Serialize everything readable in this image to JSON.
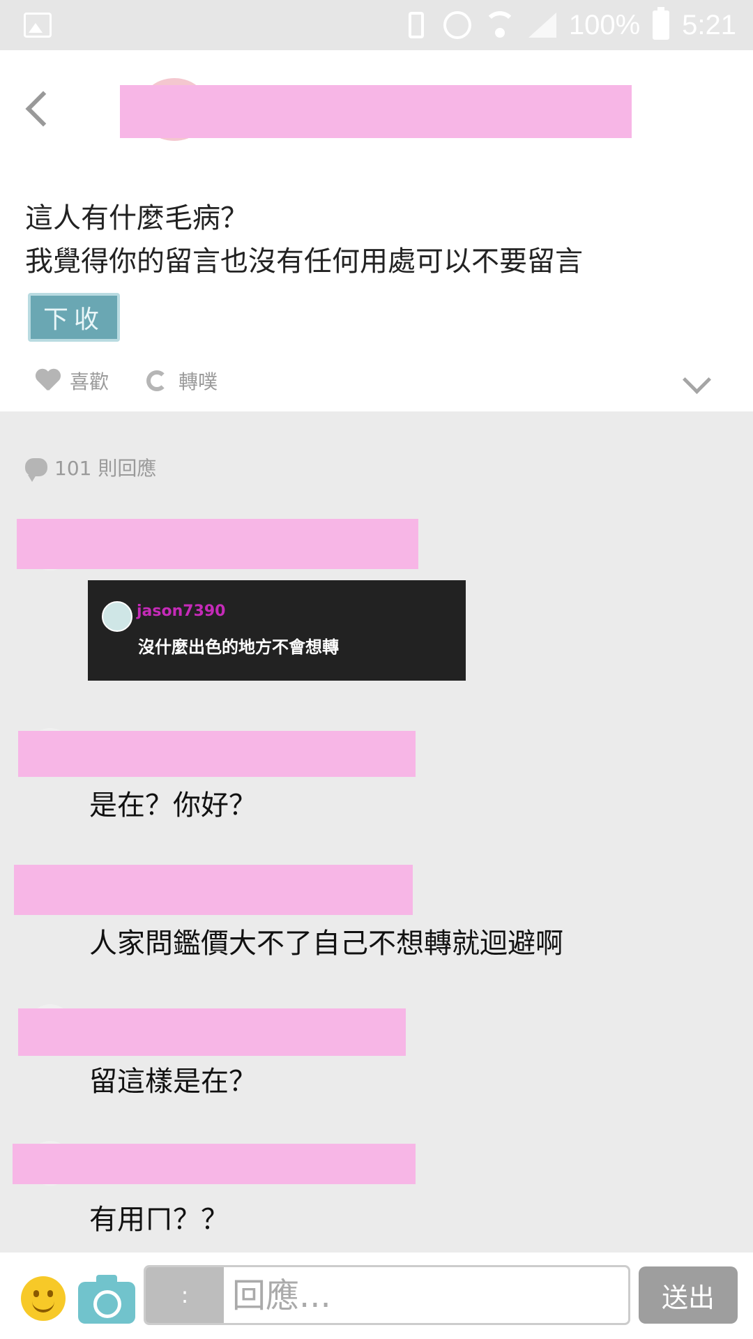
{
  "status_bar": {
    "battery": "100%",
    "time": "5:21",
    "icons": [
      "gallery-icon",
      "vibrate-icon",
      "alarm-icon",
      "wifi-icon",
      "signal-icon",
      "battery-icon"
    ]
  },
  "post": {
    "lines": [
      "這人有什麼毛病？",
      "我覺得你的留言也沒有任何用處可以不要留言"
    ],
    "sticker_text": "下收",
    "like_label": "喜歡",
    "repost_label": "轉噗"
  },
  "comments_header": {
    "count_label": "101 則回應"
  },
  "comments": [
    {
      "type": "image",
      "image": {
        "username": "jason7390",
        "text": "沒什麼出色的地方不會想轉"
      }
    },
    {
      "type": "text",
      "text": "是在？你好？"
    },
    {
      "type": "text",
      "text": "人家問鑑價大不了自己不想轉就迴避啊"
    },
    {
      "type": "text",
      "text": "留這樣是在？"
    },
    {
      "type": "text",
      "text": "有用ㄇ？？"
    }
  ],
  "composer": {
    "qualifier": ":",
    "placeholder": "回應...",
    "send_label": "送出"
  },
  "colors": {
    "redaction": "#f7b6e6",
    "background": "#ebebeb",
    "camera": "#71c3cc",
    "emoji": "#f7c928"
  }
}
